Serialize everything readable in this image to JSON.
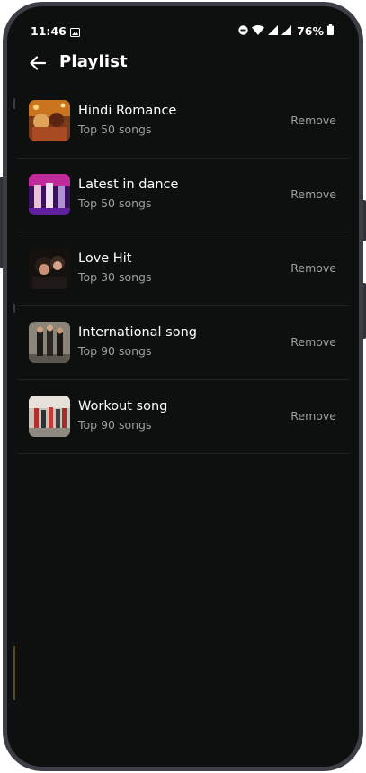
{
  "status_bar": {
    "time": "11:46",
    "battery": "76%"
  },
  "header": {
    "title": "Playlist"
  },
  "playlists": [
    {
      "name": "Hindi Romance",
      "subtitle": "Top 50 songs",
      "action": "Remove"
    },
    {
      "name": "Latest in dance",
      "subtitle": "Top 50 songs",
      "action": "Remove"
    },
    {
      "name": "Love Hit",
      "subtitle": "Top 30 songs",
      "action": "Remove"
    },
    {
      "name": "International song",
      "subtitle": "Top 90 songs",
      "action": "Remove"
    },
    {
      "name": "Workout song",
      "subtitle": "Top 90 songs",
      "action": "Remove"
    }
  ],
  "colors": {
    "background": "#0d100f",
    "text_primary": "#ffffff",
    "text_secondary": "#9a9f9c"
  }
}
